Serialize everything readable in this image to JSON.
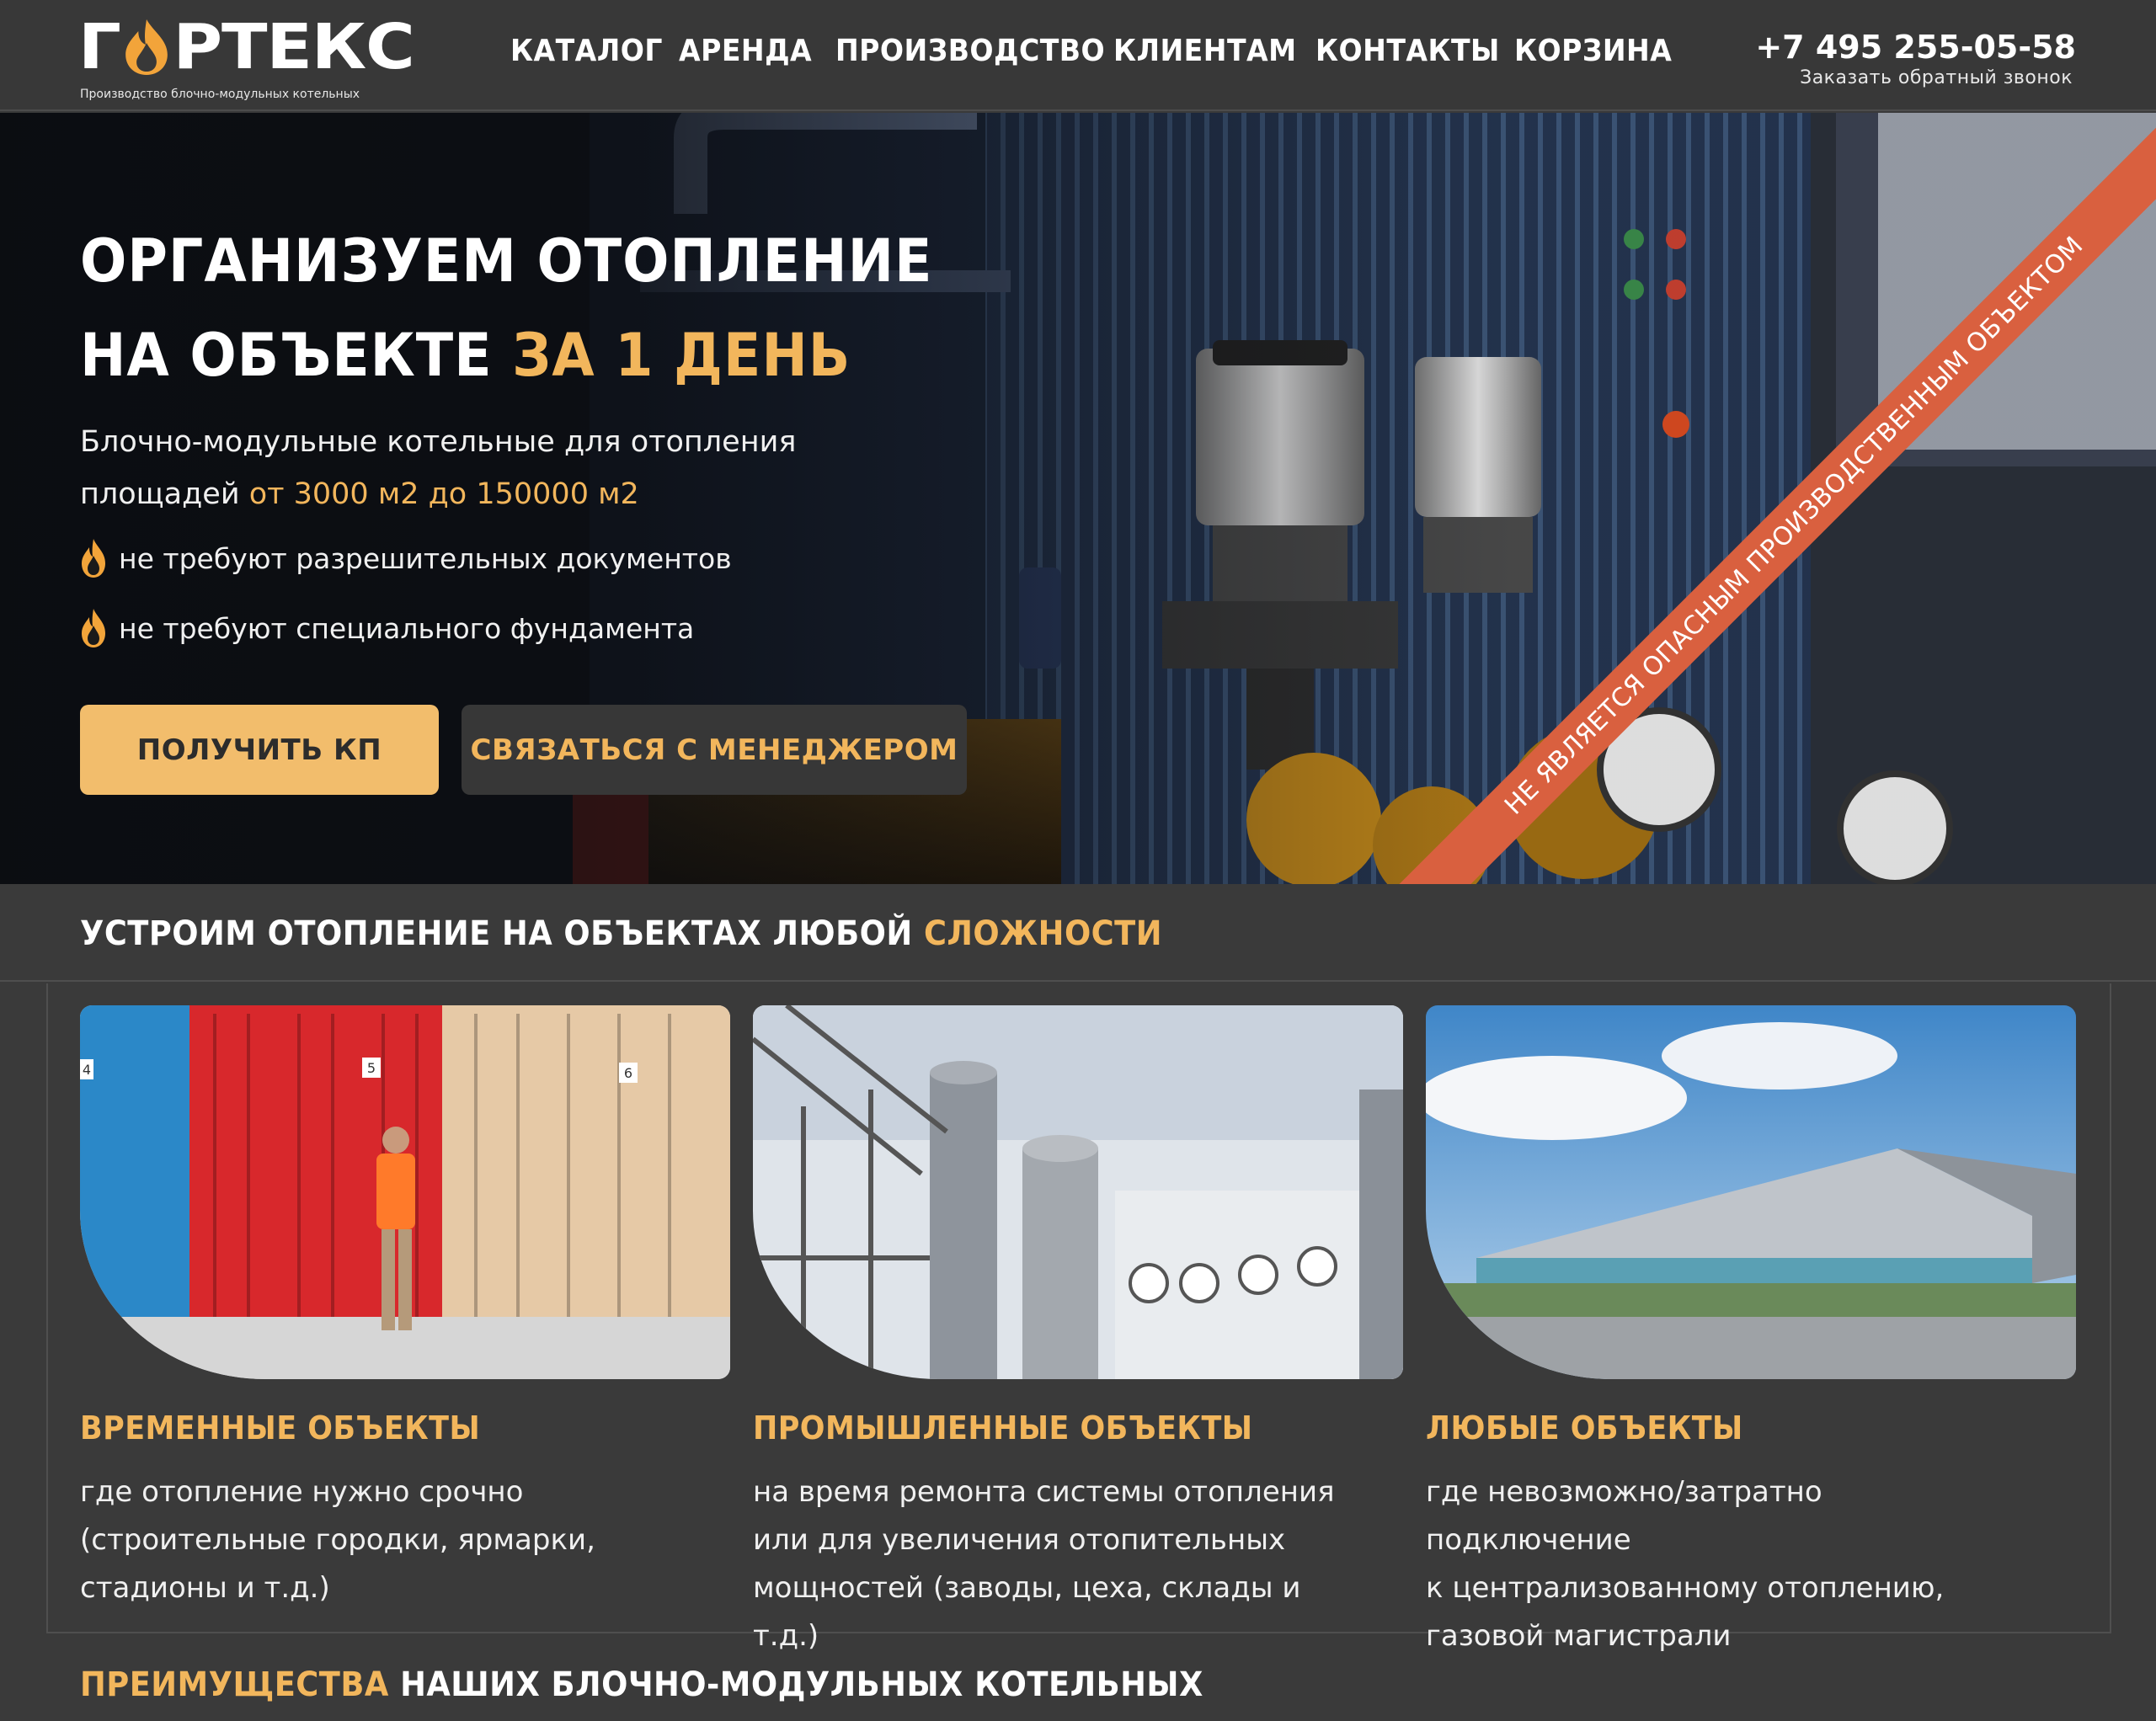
{
  "header": {
    "logo_text_left": "Г",
    "logo_text_right": "РТЕКС",
    "logo_subtitle": "Производство блочно-модульных котельных",
    "nav": [
      "КАТАЛОГ",
      "АРЕНДА",
      "ПРОИЗВОДСТВО",
      "КЛИЕНТАМ",
      "КОНТАКТЫ",
      "КОРЗИНА"
    ],
    "phone": "+7 495 255-05-58",
    "callback": "Заказать обратный звонок"
  },
  "hero": {
    "title_line1": "ОРГАНИЗУЕМ ОТОПЛЕНИЕ",
    "title_line2_plain": "НА ОБЪЕКТЕ ",
    "title_line2_accent": "ЗА 1 ДЕНЬ",
    "subtitle_line1": "Блочно-модульные котельные для отопления",
    "subtitle_line2_plain": "площадей ",
    "subtitle_line2_accent": "от 3000 м2 до 150000 м2",
    "bullets": [
      "не требуют разрешительных документов",
      "не требуют специального фундамента"
    ],
    "btn_primary": "ПОЛУЧИТЬ КП",
    "btn_secondary": "СВЯЗАТЬСЯ С МЕНЕДЖЕРОМ",
    "ribbon": "НЕ ЯВЛЯЕТСЯ ОПАСНЫМ ПРОИЗВОДСТВЕННЫМ ОБЪЕКТОМ",
    "ribbon_fragment": "НЫМ ОБЪЕКТОМ"
  },
  "objects": {
    "title_plain": "УСТРОИМ ОТОПЛЕНИЕ НА ОБЪЕКТАХ ЛЮБОЙ ",
    "title_accent": "СЛОЖНОСТИ",
    "cards": [
      {
        "title": "ВРЕМЕННЫЕ ОБЪЕКТЫ",
        "text": "где отопление нужно срочно\n(строительные городки, ярмарки,\nстадионы и т.д.)"
      },
      {
        "title": "ПРОМЫШЛЕННЫЕ ОБЪЕКТЫ",
        "text": "на время ремонта системы отопления\nили для увеличения отопительных\nмощностей (заводы, цеха, склады и т.д.)"
      },
      {
        "title": "ЛЮБЫЕ ОБЪЕКТЫ",
        "text": "где невозможно/затратно подключение\nк централизованному отоплению,\nгазовой магистрали"
      }
    ]
  },
  "advantages": {
    "title_accent": "ПРЕИМУЩЕСТВА",
    "title_plain": " НАШИХ БЛОЧНО-МОДУЛЬНЫХ КОТЕЛЬНЫХ"
  },
  "container_numbers": [
    "4",
    "5",
    "6"
  ],
  "colors": {
    "accent": "#f2b65c",
    "button_primary": "#f2bd6c",
    "ribbon": "#d9603f",
    "background": "#3a3a3a"
  }
}
